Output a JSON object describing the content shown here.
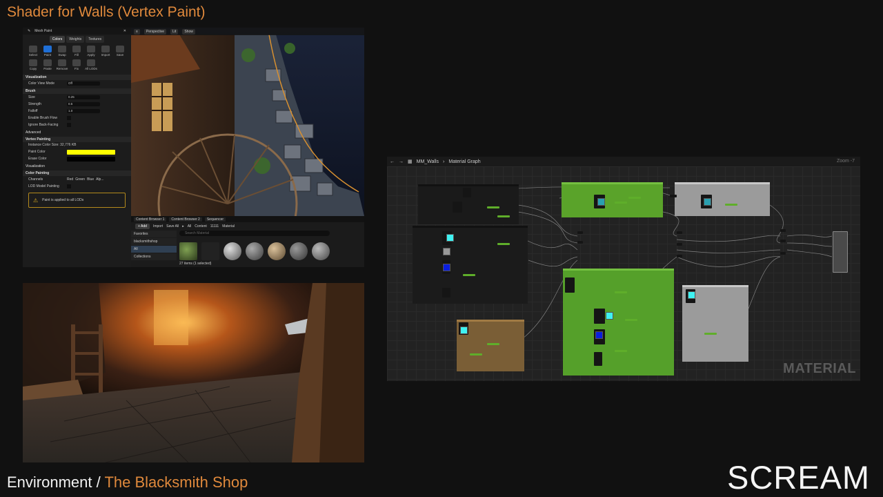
{
  "slide": {
    "title": "Shader for Walls (Vertex Paint)",
    "footer_prefix": "Environment / ",
    "footer_project": "The Blacksmith Shop",
    "logo": "SCREAM",
    "accent_color": "#e0893c"
  },
  "mesh_paint": {
    "panel_title": "Mesh Paint",
    "modes": [
      "Colors",
      "Weights",
      "Textures"
    ],
    "active_mode": "Colors",
    "tools_row1": [
      "Select",
      "Paint",
      "Swap",
      "Fill",
      "Apply",
      "Import",
      "Save"
    ],
    "tools_row2": [
      "Copy",
      "Paste",
      "Remove",
      "Fix",
      "All LODs"
    ],
    "sections": {
      "visualization": "Visualization",
      "brush": "Brush",
      "advanced": "Advanced",
      "vertex_painting": "Vertex Painting",
      "visualization2": "Visualization",
      "color_painting": "Color Painting"
    },
    "color_view_mode_label": "Color View Mode",
    "color_view_mode_value": "Off",
    "size_label": "Size",
    "size_value": "0.25",
    "strength_label": "Strength",
    "strength_value": "0.5",
    "falloff_label": "Falloff",
    "falloff_value": "1.0",
    "enable_brush_flow_label": "Enable Brush Flow",
    "ignore_back_facing_label": "Ignore Back-Facing",
    "instance_color_size": "Instance Color Size: 32,776 KB",
    "paint_color_label": "Paint Color",
    "paint_color": "#ffff00",
    "erase_color_label": "Erase Color",
    "erase_color": "#000000",
    "channels_label": "Channels",
    "channels": [
      "Red",
      "Green",
      "Blue",
      "Alp..."
    ],
    "lod_model_painting_label": "LOD Model Painting",
    "warning_text": "Paint is applied to all LODs"
  },
  "viewport": {
    "perspective": "Perspective",
    "lit": "Lit",
    "show": "Show"
  },
  "content_browser": {
    "tabs": [
      "Content Browser 1",
      "Content Browser 2",
      "Sequencer"
    ],
    "add": "Add",
    "import": "Import",
    "save_all": "Save All",
    "path": [
      "All",
      "Content",
      "11111",
      "Material"
    ],
    "search_placeholder": "Search Material",
    "favorites": "Favorites",
    "folder": "blacksmithshop",
    "all_item": "All",
    "collections": "Collections",
    "items_count": "27 items (1 selected)"
  },
  "material_graph": {
    "asset": "MM_Walls",
    "graph": "Material Graph",
    "zoom": "Zoom -7",
    "watermark": "MATERIAL"
  }
}
